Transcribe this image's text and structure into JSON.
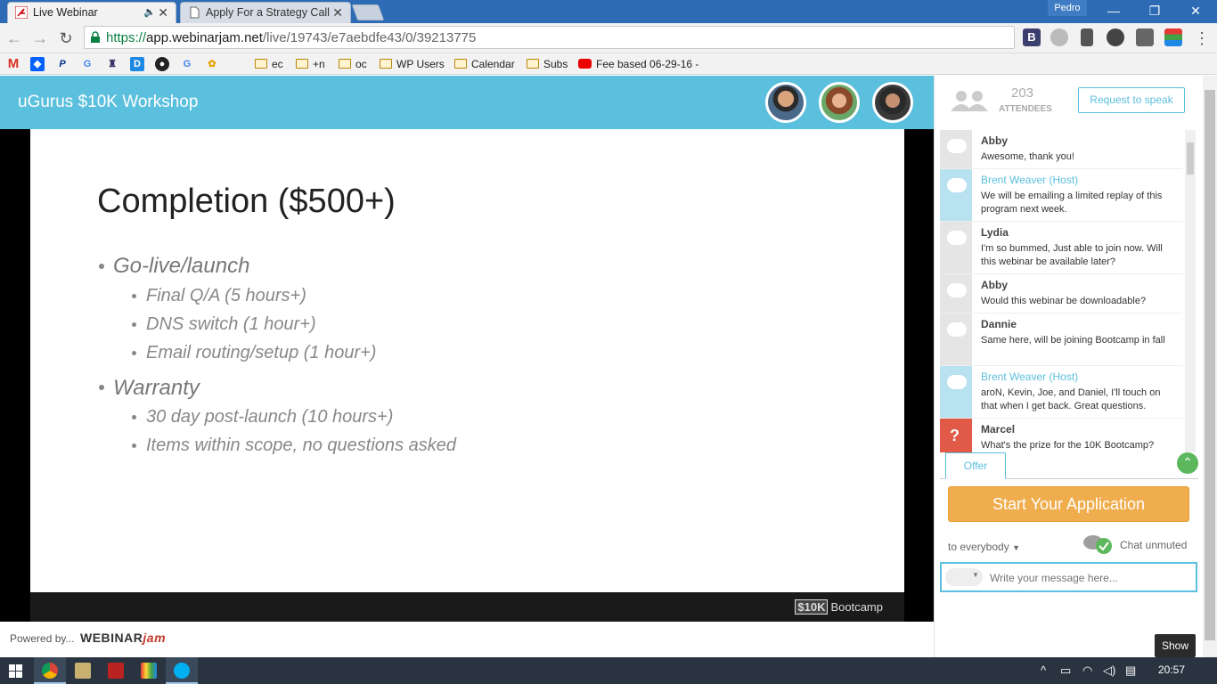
{
  "browser": {
    "tabs": [
      {
        "label": "Live Webinar",
        "active": true
      },
      {
        "label": "Apply For a Strategy Call",
        "active": false
      }
    ],
    "profile": "Pedro",
    "url_scheme": "https://",
    "url_host": "app.webinarjam.net",
    "url_path": "/live/19743/e7aebdfe43/0/39213775",
    "bookmarks": [
      {
        "label": "ec"
      },
      {
        "label": "+n"
      },
      {
        "label": "oc"
      },
      {
        "label": "WP Users"
      },
      {
        "label": "Calendar"
      },
      {
        "label": "Subs"
      },
      {
        "label": "Fee based 06-29-16 -"
      }
    ]
  },
  "header": {
    "title": "uGurus $10K Workshop"
  },
  "slide": {
    "title": "Completion ($500+)",
    "bullets": [
      {
        "text": "Go-live/launch",
        "subs": [
          "Final Q/A (5 hours+)",
          "DNS switch (1 hour+)",
          "Email routing/setup (1 hour+)"
        ]
      },
      {
        "text": "Warranty",
        "subs": [
          "30 day post-launch (10 hours+)",
          "Items within scope, no questions asked"
        ]
      }
    ],
    "footer_brand_box": "$10K",
    "footer_brand_text": "Bootcamp"
  },
  "powered": {
    "text": "Powered by...",
    "logo_main": "WEBINAR",
    "logo_jam": "jam"
  },
  "panel": {
    "attendees_count": "203",
    "attendees_label": "ATTENDEES",
    "request_label": "Request to speak",
    "messages": [
      {
        "name": "Abby",
        "body": "Awesome, thank you!",
        "kind": "user"
      },
      {
        "name": "Brent Weaver (Host)",
        "body": "We will be emailing a limited replay of this program next week.",
        "kind": "host"
      },
      {
        "name": "Lydia",
        "body": "I'm so bummed, Just able to join now. Will this webinar be available later?",
        "kind": "user"
      },
      {
        "name": "Abby",
        "body": "Would this webinar be downloadable?",
        "kind": "user"
      },
      {
        "name": "Dannie",
        "body": "Same here, will be joining Bootcamp in fall",
        "kind": "user"
      },
      {
        "name": "Brent Weaver (Host)",
        "body": "aroN, Kevin, Joe, and Daniel, I'll touch on that when I get back. Great questions.",
        "kind": "host"
      },
      {
        "name": "Marcel",
        "body": "What's the prize for the 10K Bootcamp?",
        "kind": "question"
      }
    ],
    "offer_tab": "Offer",
    "apply_label": "Start Your Application",
    "to_label": "to everybody",
    "chat_status": "Chat unmuted",
    "message_placeholder": "Write your message here...",
    "show_label": "Show"
  },
  "taskbar": {
    "clock": "20:57"
  },
  "colors": {
    "accent": "#5bbfde",
    "apply": "#f0ad4e",
    "question": "#e05a47"
  }
}
